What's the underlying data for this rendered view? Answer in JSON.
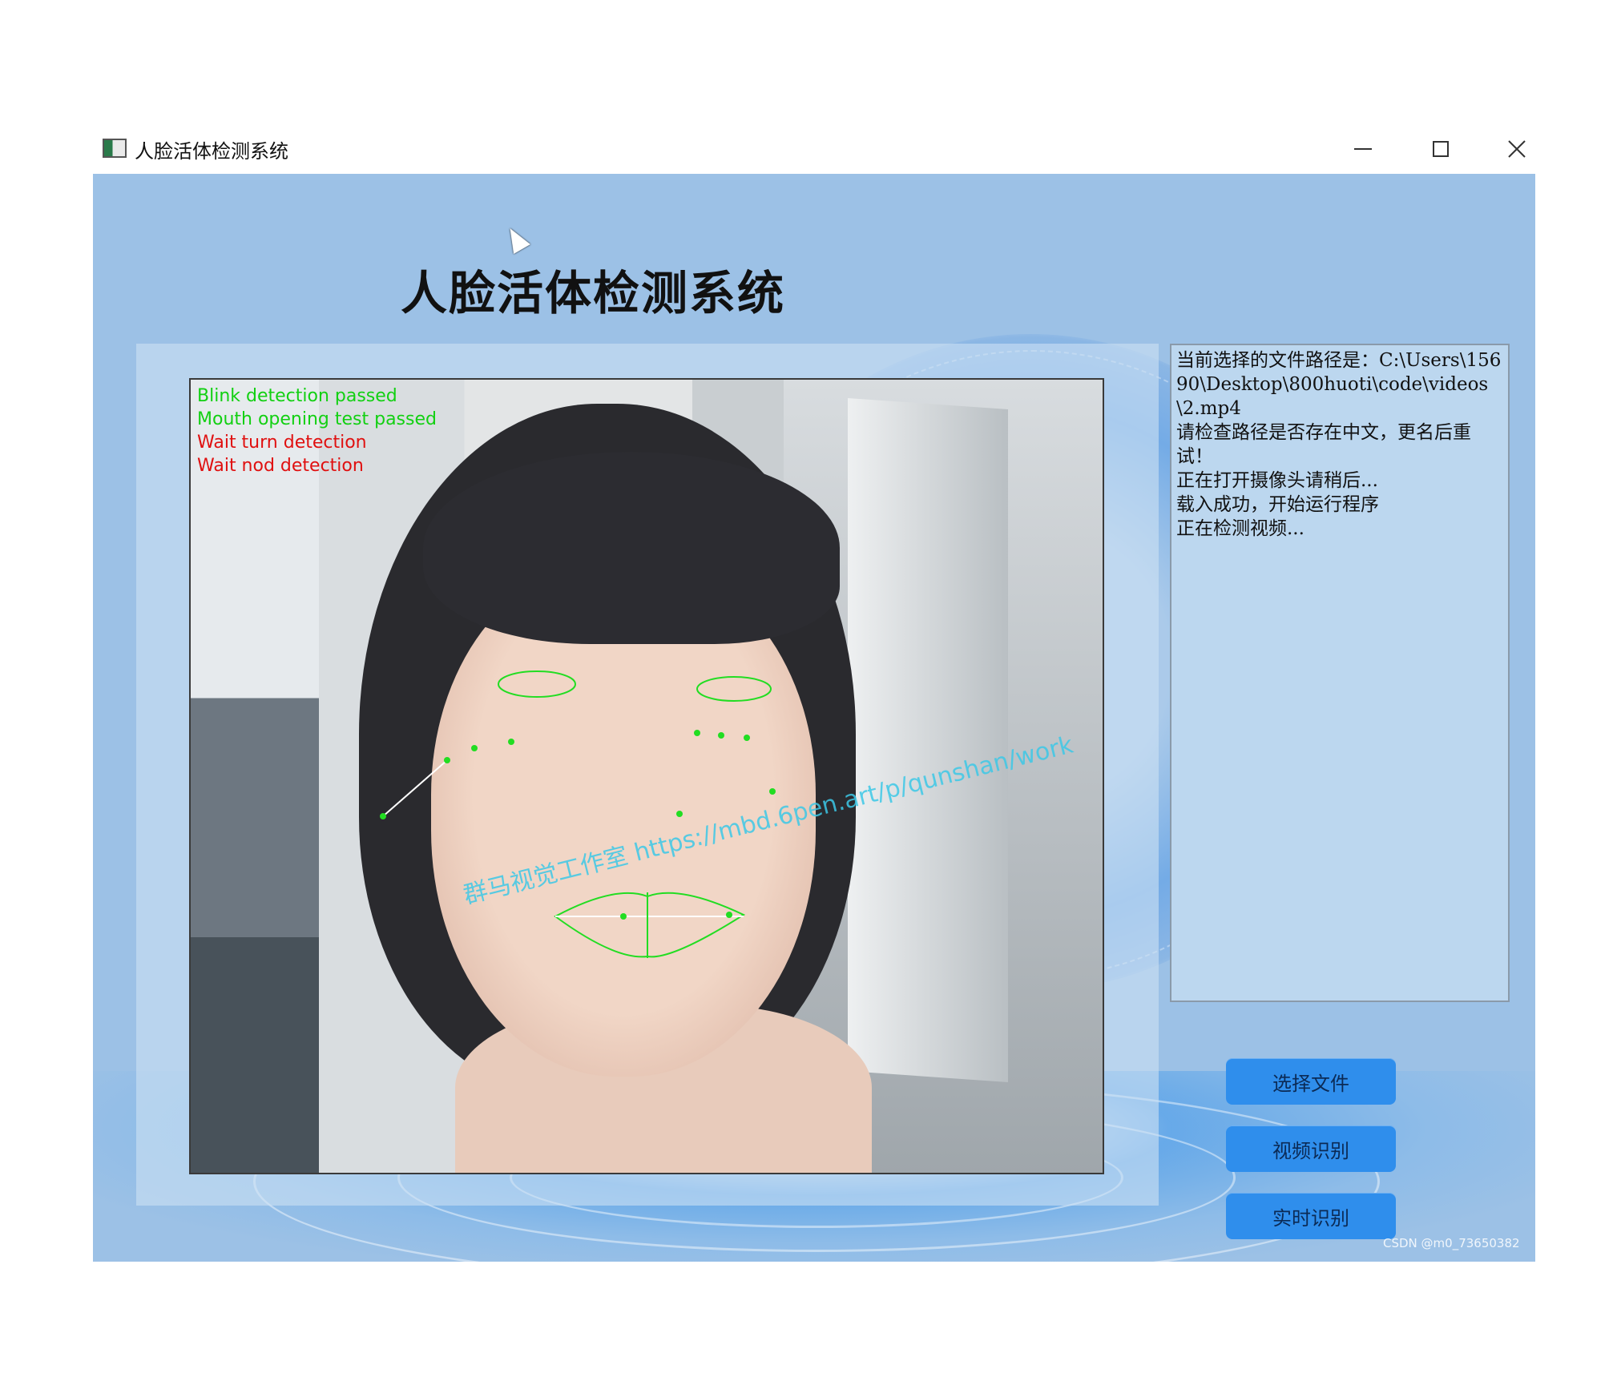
{
  "window": {
    "title": "人脸活体检测系统",
    "controls": {
      "minimize": "minimize-icon",
      "maximize": "maximize-icon",
      "close": "close-icon"
    }
  },
  "heading": "人脸活体检测系统",
  "video": {
    "overlay_lines": [
      {
        "text": "Blink detection passed",
        "color": "#12d012"
      },
      {
        "text": "Mouth opening test passed",
        "color": "#12d012"
      },
      {
        "text": "Wait turn detection",
        "color": "#e01010"
      },
      {
        "text": "Wait nod detection",
        "color": "#e01010"
      }
    ],
    "watermark": "群马视觉工作室 https://mbd.6pen.art/p/qunshan/work"
  },
  "log": {
    "lines": [
      "当前选择的文件路径是：C:\\Users\\15690\\Desktop\\800huoti\\code\\videos\\2.mp4",
      "请检查路径是否存在中文，更名后重试！",
      "正在打开摄像头请稍后...",
      "载入成功，开始运行程序",
      "正在检测视频..."
    ]
  },
  "buttons": {
    "select_file": "选择文件",
    "video_recognition": "视频识别",
    "realtime_recognition": "实时识别"
  },
  "footer_watermark": "CSDN @m0_73650382",
  "colors": {
    "client_bg": "#9cc1e6",
    "button_bg": "#2f8eec",
    "log_bg": "#bcd7ef",
    "overlay_pass": "#12d012",
    "overlay_wait": "#e01010"
  }
}
